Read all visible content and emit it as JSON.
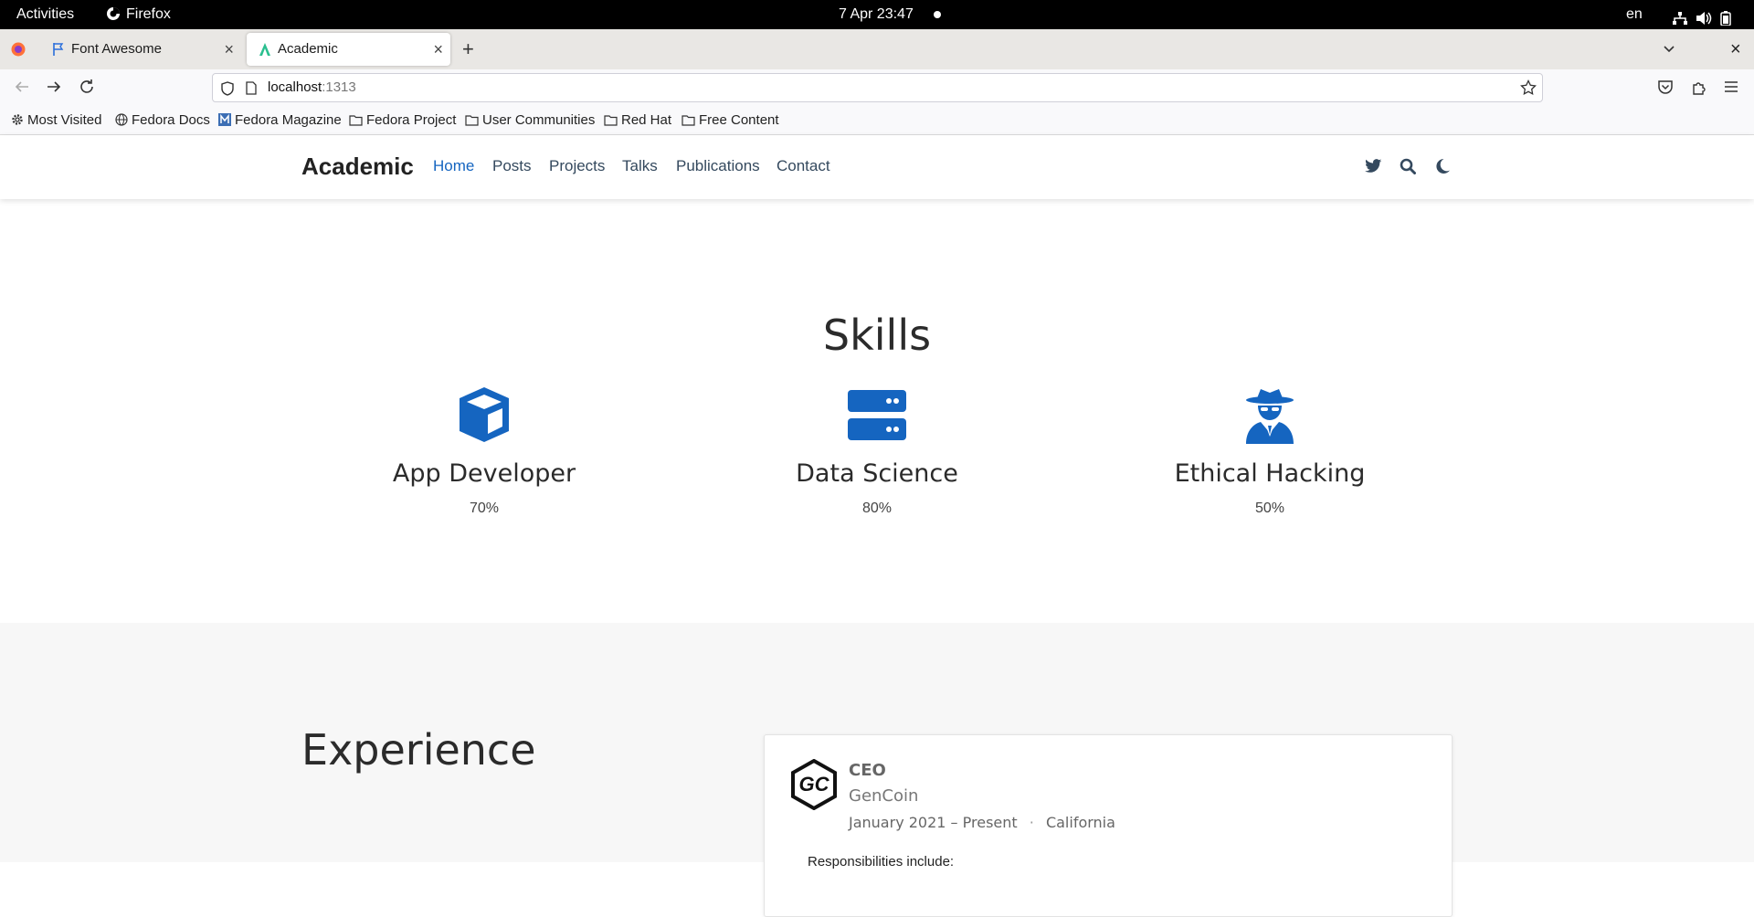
{
  "system_bar": {
    "activities": "Activities",
    "app_name": "Firefox",
    "clock": "7 Apr  23:47",
    "language": "en"
  },
  "tabs": [
    {
      "label": "Font Awesome"
    },
    {
      "label": "Academic"
    }
  ],
  "address_bar": {
    "host": "localhost",
    "port": ":1313"
  },
  "bookmarks": [
    "Most Visited",
    "Fedora Docs",
    "Fedora Magazine",
    "Fedora Project",
    "User Communities",
    "Red Hat",
    "Free Content"
  ],
  "site": {
    "brand": "Academic",
    "nav": [
      "Home",
      "Posts",
      "Projects",
      "Talks",
      "Publications",
      "Contact"
    ],
    "active_nav": "Home",
    "accent": "#1565c0"
  },
  "skills": {
    "title": "Skills",
    "items": [
      {
        "name": "App Developer",
        "percent": "70%",
        "icon": "cube-icon"
      },
      {
        "name": "Data Science",
        "percent": "80%",
        "icon": "server-icon"
      },
      {
        "name": "Ethical Hacking",
        "percent": "50%",
        "icon": "user-secret-icon"
      }
    ]
  },
  "experience": {
    "title": "Experience",
    "entry": {
      "logo_text": "GC",
      "role": "CEO",
      "company": "GenCoin",
      "dates": "January 2021 – Present",
      "separator": "·",
      "location": "California",
      "description_start": "Responsibilities include:"
    }
  }
}
